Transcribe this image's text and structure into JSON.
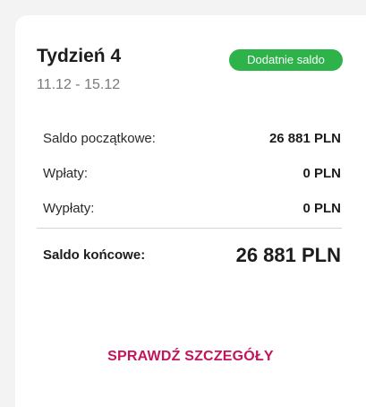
{
  "week": {
    "title": "Tydzień 4",
    "dates": "11.12 - 15.12",
    "badge": "Dodatnie saldo"
  },
  "rows": [
    {
      "label": "Saldo początkowe:",
      "value": "26 881 PLN"
    },
    {
      "label": "Wpłaty:",
      "value": "0 PLN"
    },
    {
      "label": "Wypłaty:",
      "value": "0 PLN"
    }
  ],
  "final": {
    "label": "Saldo końcowe:",
    "value": "26 881 PLN"
  },
  "actions": {
    "details_label": "SPRAWDŹ SZCZEGÓŁY"
  },
  "colors": {
    "badge_green": "#2eb24a",
    "accent_magenta": "#c4155c",
    "background": "#f3f3f3",
    "card": "#ffffff"
  }
}
